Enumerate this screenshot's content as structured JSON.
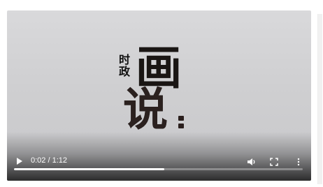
{
  "video": {
    "poster_text": {
      "small_line_1": "时",
      "small_line_2": "政",
      "large_line_1": "画",
      "large_line_2": "说"
    },
    "time_display": "0:02 / 1:12",
    "progress": 0.52
  },
  "icons": {
    "play": "play-icon",
    "volume": "volume-icon",
    "fullscreen": "fullscreen-icon",
    "more": "more-vertical-icon"
  }
}
